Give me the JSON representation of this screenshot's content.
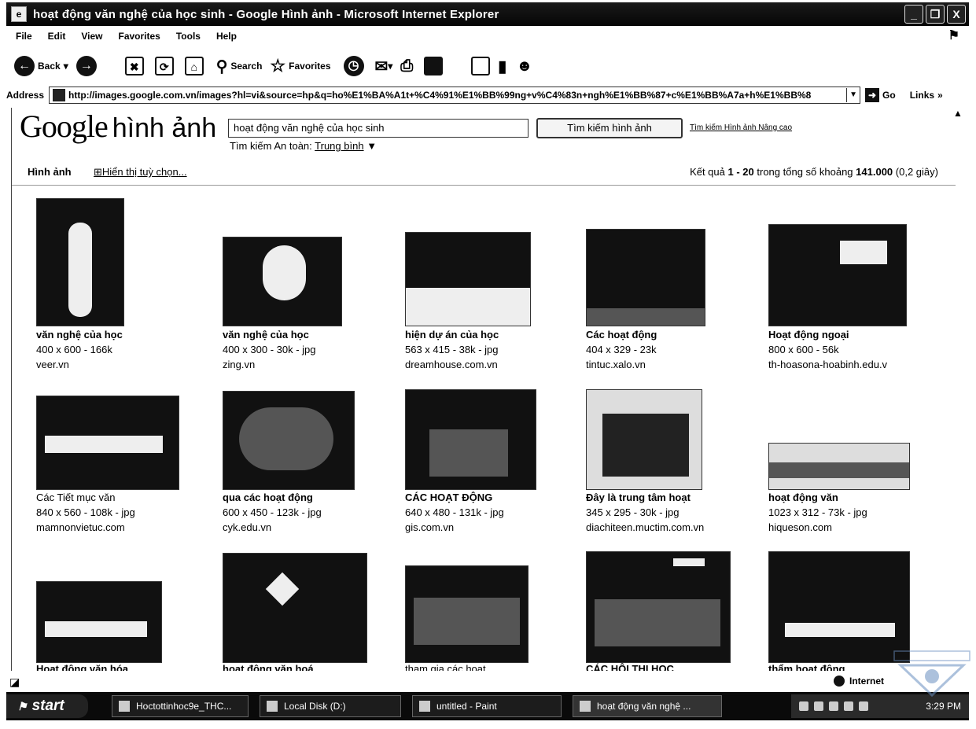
{
  "window": {
    "title": "hoạt động văn nghệ của học sinh - Google Hình ảnh - Microsoft Internet Explorer",
    "buttons": [
      "_",
      "❐",
      "X"
    ]
  },
  "menu": [
    "File",
    "Edit",
    "View",
    "Favorites",
    "Tools",
    "Help"
  ],
  "toolbar": {
    "back": "Back",
    "search": "Search",
    "favorites": "Favorites"
  },
  "address": {
    "label": "Address",
    "url": "http://images.google.com.vn/images?hl=vi&source=hp&q=ho%E1%BA%A1t+%C4%91%E1%BB%99ng+v%C4%83n+ngh%E1%BB%87+c%E1%BB%A7a+h%E1%BB%8",
    "go": "Go",
    "links": "Links"
  },
  "google": {
    "logo": "Google",
    "logo_sub": "hình ảnh",
    "query": "hoạt động văn nghệ của học sinh",
    "search_button": "Tìm kiếm hình ảnh",
    "advanced": "Tìm kiếm Hình ảnh Nâng cao",
    "safe_label": "Tìm kiếm An toàn:",
    "safe_value": "Trung bình",
    "section": "Hình ảnh",
    "options": "Hiển thị tuỳ chọn...",
    "results_prefix": "Kết quả",
    "results_range": "1 - 20",
    "results_mid": "trong tổng số khoảng",
    "results_total": "141.000",
    "results_time": "(0,2 giây)"
  },
  "results": [
    {
      "title": "văn nghệ của học",
      "meta": "400 x 600 - 166k",
      "site": "veer.vn"
    },
    {
      "title": "văn nghệ của học",
      "meta": "400 x 300 - 30k - jpg",
      "site": "zing.vn"
    },
    {
      "title": "hiện dự án của học",
      "meta": "563 x 415 - 38k - jpg",
      "site": "dreamhouse.com.vn"
    },
    {
      "title": "Các hoạt động",
      "meta": "404 x 329 - 23k",
      "site": "tintuc.xalo.vn"
    },
    {
      "title": "Hoạt động ngoại",
      "meta": "800 x 600 - 56k",
      "site": "th-hoasona-hoabinh.edu.v"
    },
    {
      "title": "Các Tiết mục văn",
      "meta": "840 x 560 - 108k - jpg",
      "site": "mamnonvietuc.com"
    },
    {
      "title": "qua các hoạt động",
      "meta": "600 x 450 - 123k - jpg",
      "site": "cyk.edu.vn"
    },
    {
      "title": "CÁC HOẠT ĐỘNG",
      "meta": "640 x 480 - 131k - jpg",
      "site": "gis.com.vn"
    },
    {
      "title": "Đây là trung tâm hoạt",
      "meta": "345 x 295 - 30k - jpg",
      "site": "diachiteen.muctim.com.vn"
    },
    {
      "title": "hoạt động văn",
      "meta": "1023 x 312 - 73k - jpg",
      "site": "hiqueson.com"
    },
    {
      "title": "Hoạt động văn hóa",
      "meta": "",
      "site": ""
    },
    {
      "title": "hoạt động văn hoá",
      "meta": "",
      "site": ""
    },
    {
      "title": "tham gia các hoạt",
      "meta": "",
      "site": ""
    },
    {
      "title": "CÁC HỘI THI HỌC",
      "meta": "",
      "site": ""
    },
    {
      "title": "thẩm hoạt động",
      "meta": "",
      "site": ""
    }
  ],
  "status": {
    "zone": "Internet"
  },
  "taskbar": {
    "start": "start",
    "tasks": [
      "Hoctottinhoc9e_THC...",
      "Local Disk (D:)",
      "untitled - Paint",
      "hoạt động văn nghệ ..."
    ],
    "clock": "3:29 PM"
  }
}
